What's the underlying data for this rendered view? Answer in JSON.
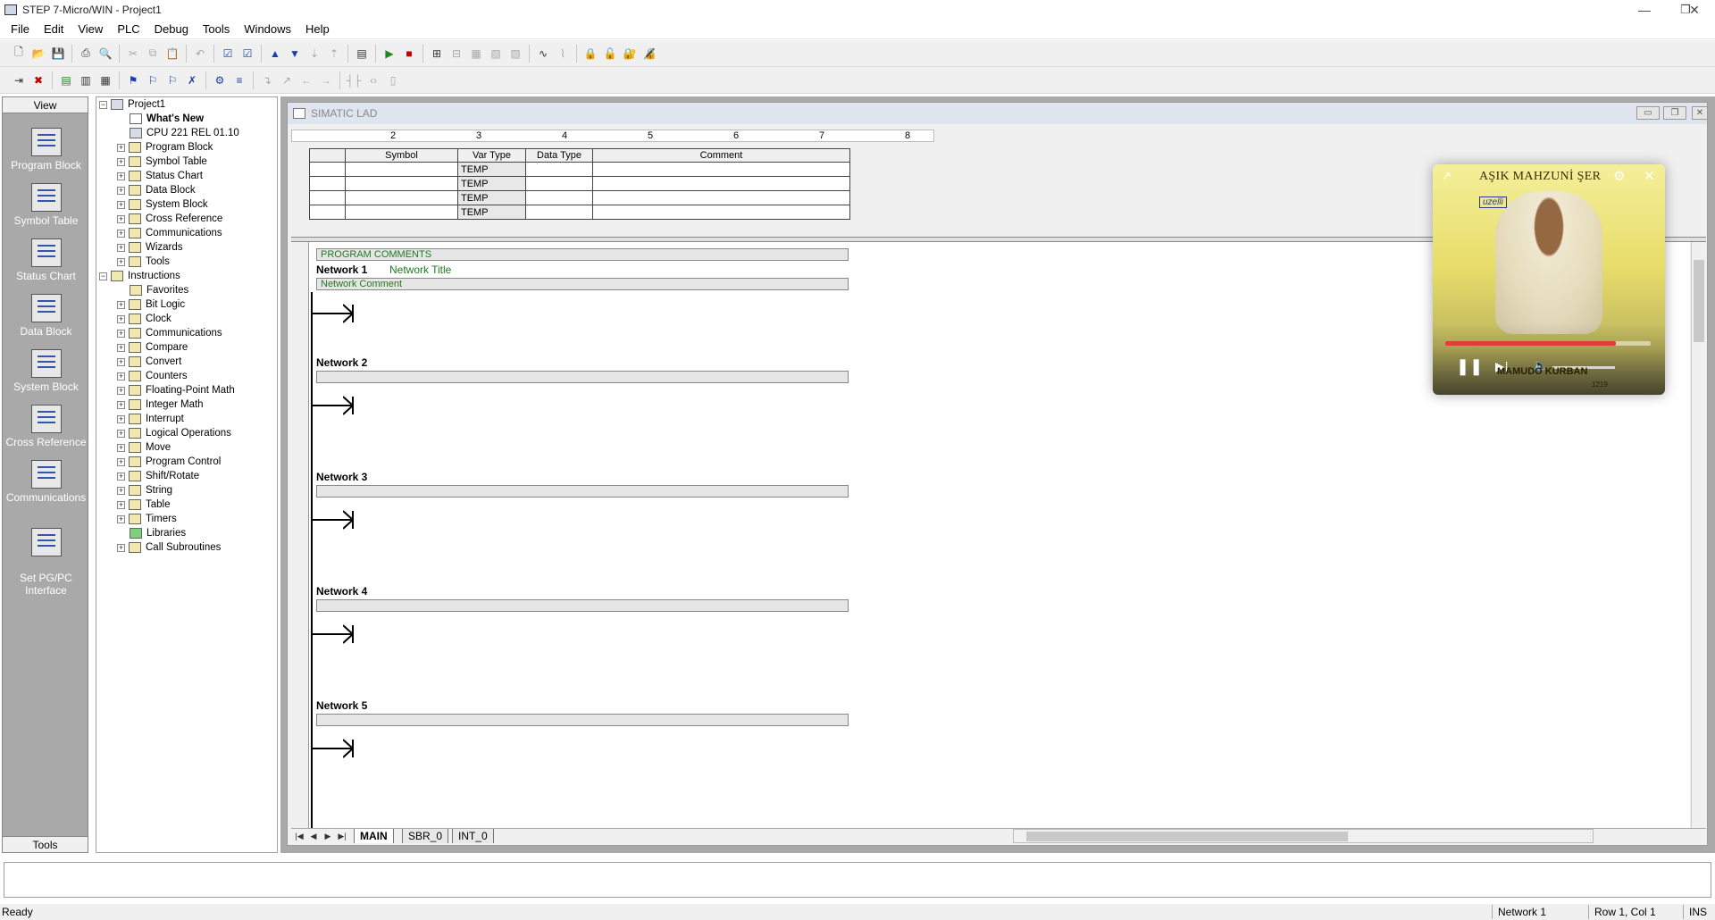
{
  "window": {
    "title": "STEP 7-Micro/WIN - Project1",
    "controls": [
      "—",
      "❐",
      "✕"
    ]
  },
  "menu": [
    "File",
    "Edit",
    "View",
    "PLC",
    "Debug",
    "Tools",
    "Windows",
    "Help"
  ],
  "viewbar": {
    "header": "View",
    "footer": "Tools",
    "items": [
      "Program Block",
      "Symbol Table",
      "Status Chart",
      "Data Block",
      "System Block",
      "Cross Reference",
      "Communications",
      "Set PG/PC\nInterface"
    ]
  },
  "tree": {
    "root": "Project1",
    "project_items": [
      "What's New",
      "CPU 221 REL 01.10",
      "Program Block",
      "Symbol Table",
      "Status Chart",
      "Data Block",
      "System Block",
      "Cross Reference",
      "Communications",
      "Wizards",
      "Tools"
    ],
    "instructions_label": "Instructions",
    "instruction_items": [
      "Favorites",
      "Bit Logic",
      "Clock",
      "Communications",
      "Compare",
      "Convert",
      "Counters",
      "Floating-Point Math",
      "Integer Math",
      "Interrupt",
      "Logical Operations",
      "Move",
      "Program Control",
      "Shift/Rotate",
      "String",
      "Table",
      "Timers",
      "Libraries",
      "Call Subroutines"
    ]
  },
  "lad": {
    "title": "SIMATIC LAD",
    "ruler": [
      "2",
      "3",
      "4",
      "5",
      "6",
      "7",
      "8"
    ],
    "table_headers": [
      "Symbol",
      "Var Type",
      "Data Type",
      "Comment"
    ],
    "var_types": [
      "TEMP",
      "TEMP",
      "TEMP",
      "TEMP"
    ],
    "program_comments": "PROGRAM COMMENTS",
    "networks": [
      {
        "name": "Network 1",
        "title": "Network Title",
        "comment": "Network Comment"
      },
      {
        "name": "Network 2",
        "title": "",
        "comment": ""
      },
      {
        "name": "Network 3",
        "title": "",
        "comment": ""
      },
      {
        "name": "Network 4",
        "title": "",
        "comment": ""
      },
      {
        "name": "Network 5",
        "title": "",
        "comment": ""
      }
    ],
    "tabs": [
      "MAIN",
      "SBR_0",
      "INT_0"
    ],
    "active_tab": "MAIN"
  },
  "media": {
    "title": "AŞIK MAHZUNİ ŞER",
    "label": "uzelli",
    "caption": "MAMUDO KURBAN",
    "catalog": "1219",
    "progress_fraction": 0.83
  },
  "status": {
    "left": "Ready",
    "network": "Network 1",
    "position": "Row 1, Col 1",
    "mode": "INS"
  }
}
